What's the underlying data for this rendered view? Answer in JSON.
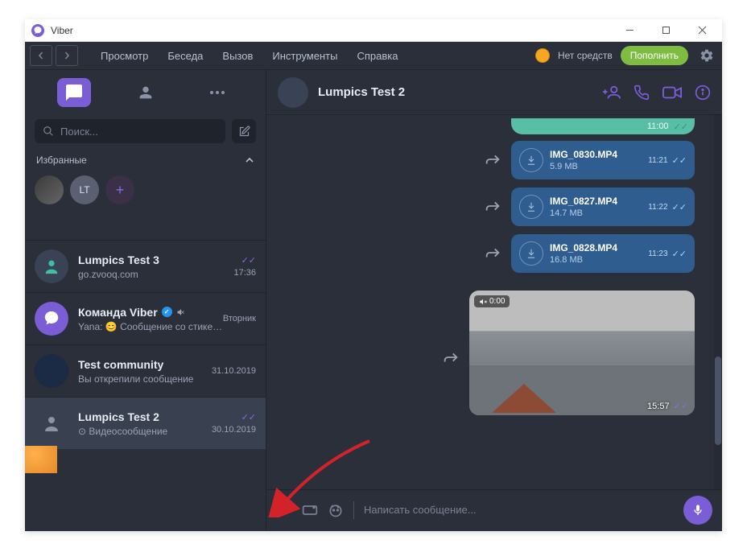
{
  "window": {
    "title": "Viber"
  },
  "menu": {
    "items": [
      "Просмотр",
      "Беседа",
      "Вызов",
      "Инструменты",
      "Справка"
    ],
    "balance": "Нет средств",
    "topup": "Пополнить"
  },
  "sidebar": {
    "search_placeholder": "Поиск...",
    "favorites_label": "Избранные",
    "fav_lt": "LT",
    "chats": [
      {
        "title": "Lumpics Test 3",
        "sub": "go.zvooq.com",
        "time": "17:36"
      },
      {
        "title": "Команда Viber",
        "sub": "Yana: 😊 Сообщение со стикером",
        "time": "Вторник"
      },
      {
        "title": "Test community",
        "sub": "Вы открепили сообщение",
        "time": "31.10.2019"
      },
      {
        "title": "Lumpics Test 2",
        "sub": "⊙ Видеосообщение",
        "time": "30.10.2019"
      }
    ]
  },
  "chat": {
    "title": "Lumpics Test 2",
    "prev_time": "11:00",
    "files": [
      {
        "name": "IMG_0830.MP4",
        "size": "5.9 MB",
        "time": "11:21"
      },
      {
        "name": "IMG_0827.MP4",
        "size": "14.7 MB",
        "time": "11:22"
      },
      {
        "name": "IMG_0828.MP4",
        "size": "16.8 MB",
        "time": "11:23"
      }
    ],
    "video": {
      "mute_time": "0:00",
      "time": "15:57"
    },
    "composer_placeholder": "Написать сообщение..."
  }
}
